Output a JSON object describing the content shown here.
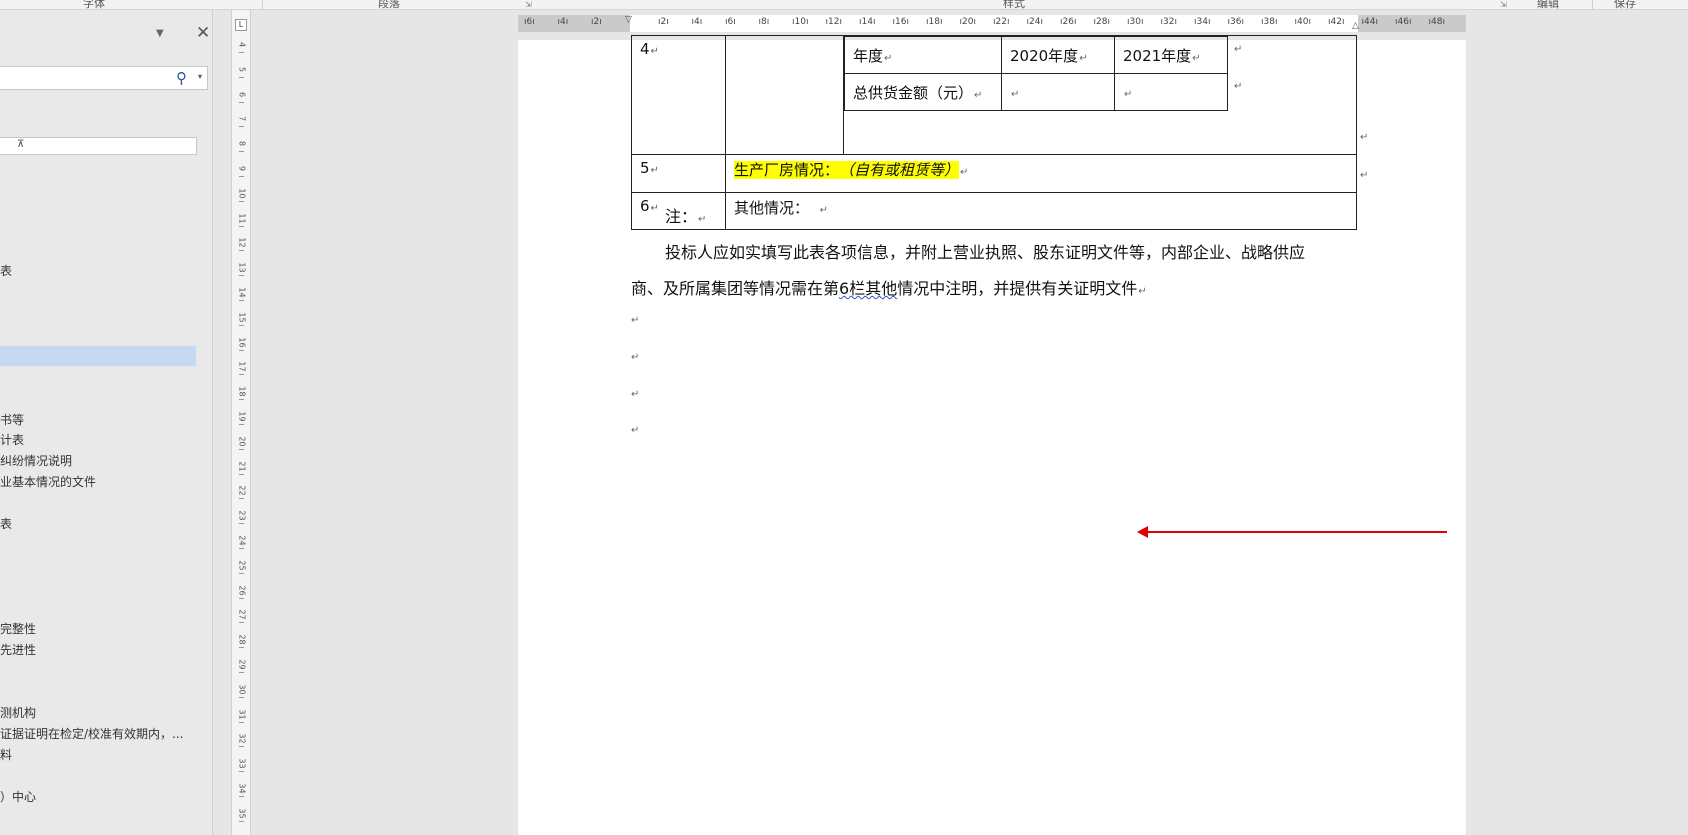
{
  "ribbon": {
    "groups": [
      "字体",
      "段落",
      "样式",
      "编辑",
      "保存"
    ]
  },
  "nav": {
    "close": "✕",
    "dropdown": "▼",
    "search_icon": "🔍",
    "search_caret": "▾",
    "collapse_symbol": "⊼",
    "items": [
      "表",
      "书等",
      "计表",
      "纠纷情况说明",
      "业基本情况的文件",
      "表",
      "完整性",
      "先进性",
      "测机构",
      "证据证明在检定/校准有效期内，...",
      "料",
      "）中心"
    ]
  },
  "vruler": {
    "corner": "L",
    "ticks": [
      "4",
      "5",
      "6",
      "7",
      "8",
      "9",
      "10",
      "11",
      "12",
      "13",
      "14",
      "15",
      "16",
      "17",
      "18",
      "19",
      "20",
      "21",
      "22",
      "23",
      "24",
      "25",
      "26",
      "27",
      "28",
      "29",
      "30",
      "31",
      "32",
      "33",
      "34",
      "35"
    ]
  },
  "hruler": {
    "ticks": [
      "6",
      "4",
      "2",
      "",
      "2",
      "4",
      "6",
      "8",
      "10",
      "12",
      "14",
      "16",
      "18",
      "20",
      "22",
      "24",
      "26",
      "28",
      "30",
      "32",
      "34",
      "36",
      "38",
      "40",
      "42",
      "44",
      "46",
      "48"
    ]
  },
  "table": {
    "row4_num": "4",
    "inner": {
      "year_label": "年度",
      "year_2020": "2020年度",
      "year_2021": "2021年度",
      "amount_label": "总供货金额（元）"
    },
    "row5_num": "5",
    "row5_label": "生产厂房情况：",
    "row5_value": "（自有或租赁等）",
    "row6_num": "6",
    "row6_label": "其他情况："
  },
  "body": {
    "note_label": "注：",
    "para_line1": "投标人应如实填写此表各项信息，并附上营业执照、股东证明文件等，内部企业、战略供应",
    "para_line2_a": "商、及所属集团等情况需在第",
    "para_line2_b": "6栏其他",
    "para_line2_c": "情况中注明，并提供有关证明文件",
    "para_mark": "↵"
  },
  "colors": {
    "highlight": "#ffff00",
    "arrow": "#e00000",
    "nav_selected": "#c5d9f5"
  }
}
